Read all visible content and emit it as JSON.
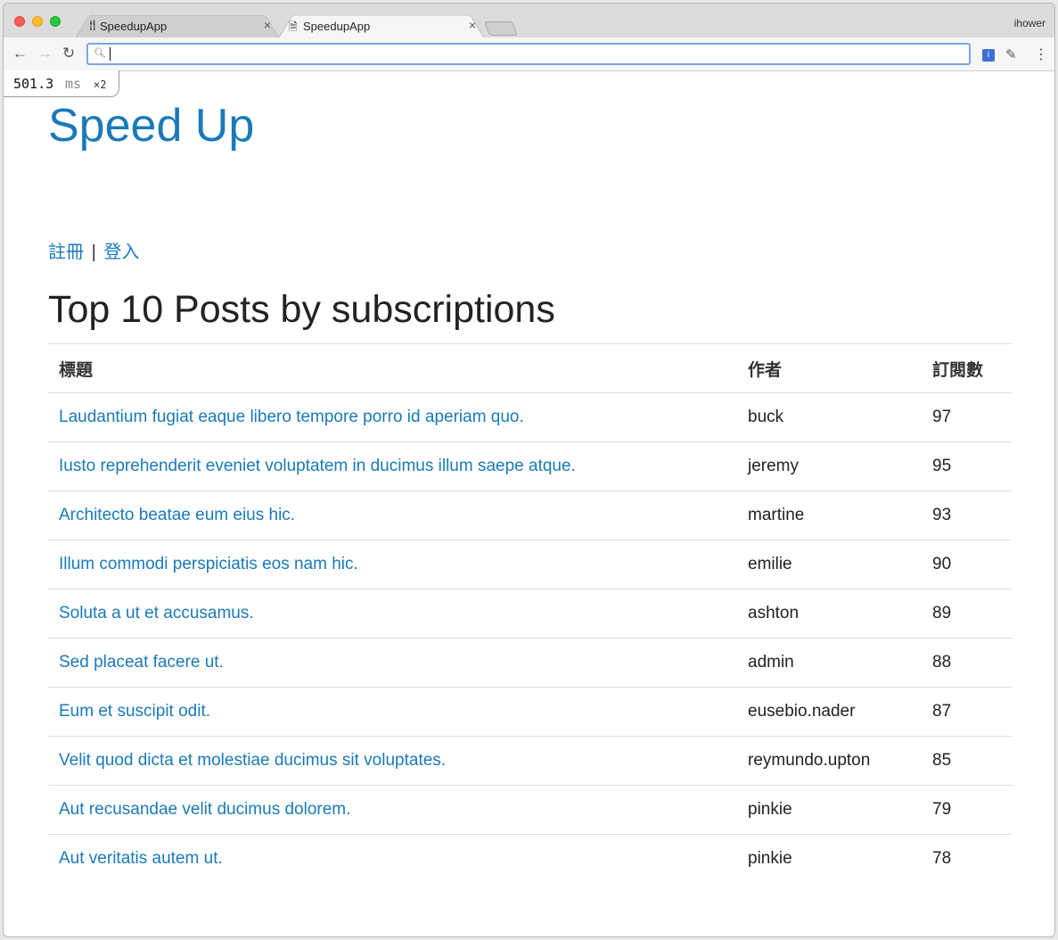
{
  "browser": {
    "tabs": [
      {
        "title": "SpeedupApp",
        "favicon": "fork-knife-icon",
        "active": false
      },
      {
        "title": "SpeedupApp",
        "favicon": "document-icon",
        "active": true
      }
    ],
    "profile_name": "ihower",
    "address": ""
  },
  "perf_badge": {
    "value": "501.3",
    "unit": "ms",
    "count": "×2"
  },
  "site": {
    "title": "Speed Up",
    "auth_links": {
      "register": "註冊",
      "separator": "|",
      "login": "登入"
    }
  },
  "main": {
    "heading": "Top 10 Posts by subscriptions",
    "table": {
      "headers": [
        "標題",
        "作者",
        "訂閱數"
      ],
      "rows": [
        {
          "title": "Laudantium fugiat eaque libero tempore porro id aperiam quo.",
          "author": "buck",
          "subscriptions": "97"
        },
        {
          "title": "Iusto reprehenderit eveniet voluptatem in ducimus illum saepe atque.",
          "author": "jeremy",
          "subscriptions": "95"
        },
        {
          "title": "Architecto beatae eum eius hic.",
          "author": "martine",
          "subscriptions": "93"
        },
        {
          "title": "Illum commodi perspiciatis eos nam hic.",
          "author": "emilie",
          "subscriptions": "90"
        },
        {
          "title": "Soluta a ut et accusamus.",
          "author": "ashton",
          "subscriptions": "89"
        },
        {
          "title": "Sed placeat facere ut.",
          "author": "admin",
          "subscriptions": "88"
        },
        {
          "title": "Eum et suscipit odit.",
          "author": "eusebio.nader",
          "subscriptions": "87"
        },
        {
          "title": "Velit quod dicta et molestiae ducimus sit voluptates.",
          "author": "reymundo.upton",
          "subscriptions": "85"
        },
        {
          "title": "Aut recusandae velit ducimus dolorem.",
          "author": "pinkie",
          "subscriptions": "79"
        },
        {
          "title": "Aut veritatis autem ut.",
          "author": "pinkie",
          "subscriptions": "78"
        }
      ]
    }
  },
  "colors": {
    "link": "#1a7ab8",
    "text": "#222222",
    "rule": "#dddddd"
  }
}
